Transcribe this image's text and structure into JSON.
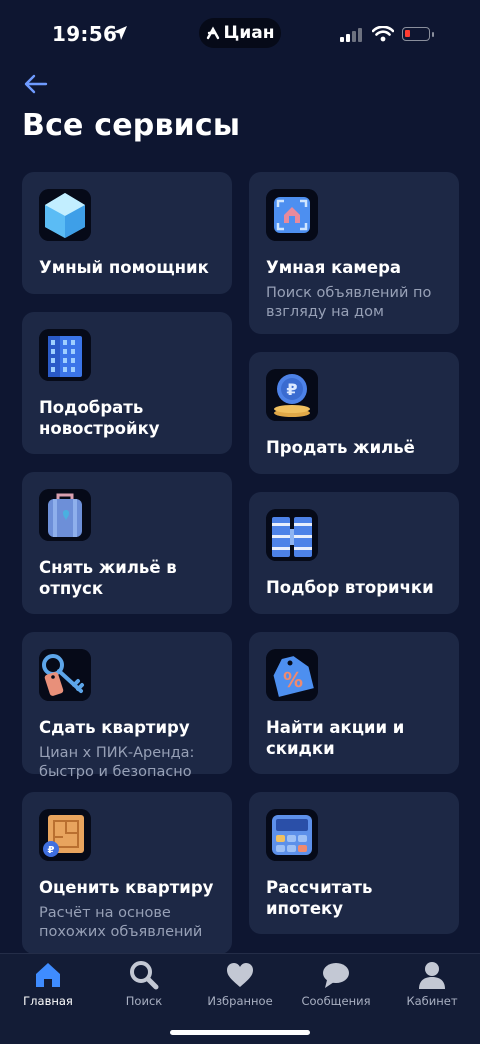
{
  "status_bar": {
    "time": "19:56",
    "app_pill": "Циан"
  },
  "page": {
    "title": "Все сервисы"
  },
  "colors": {
    "background": "#0e1631",
    "card": "#1d2845",
    "accent": "#3f7bff",
    "subtitle": "#97a0b6"
  },
  "services_left": [
    {
      "title": "Умный помощник",
      "subtitle": "",
      "icon": "crystal-icon"
    },
    {
      "title": "Подобрать новостройку",
      "subtitle": "",
      "icon": "building-icon"
    },
    {
      "title": "Снять жильё в отпуск",
      "subtitle": "",
      "icon": "suitcase-icon"
    },
    {
      "title": "Сдать квартиру",
      "subtitle": "Циан х ПИК-Аренда: быстро и безопасно",
      "icon": "keys-icon"
    },
    {
      "title": "Оценить квартиру",
      "subtitle": "Расчёт на основе похожих объявлений",
      "icon": "floorplan-icon"
    }
  ],
  "services_right": [
    {
      "title": "Умная камера",
      "subtitle": "Поиск объявлений по взгляду на дом",
      "icon": "camera-scan-icon"
    },
    {
      "title": "Продать жильё",
      "subtitle": "",
      "icon": "coin-icon"
    },
    {
      "title": "Подбор вторички",
      "subtitle": "",
      "icon": "apartment-block-icon"
    },
    {
      "title": "Найти акции и скидки",
      "subtitle": "",
      "icon": "discount-tag-icon"
    },
    {
      "title": "Рассчитать ипотеку",
      "subtitle": "",
      "icon": "calculator-icon"
    }
  ],
  "tabbar": {
    "home": "Главная",
    "search": "Поиск",
    "favorites": "Избранное",
    "messages": "Сообщения",
    "cabinet": "Кабинет"
  }
}
